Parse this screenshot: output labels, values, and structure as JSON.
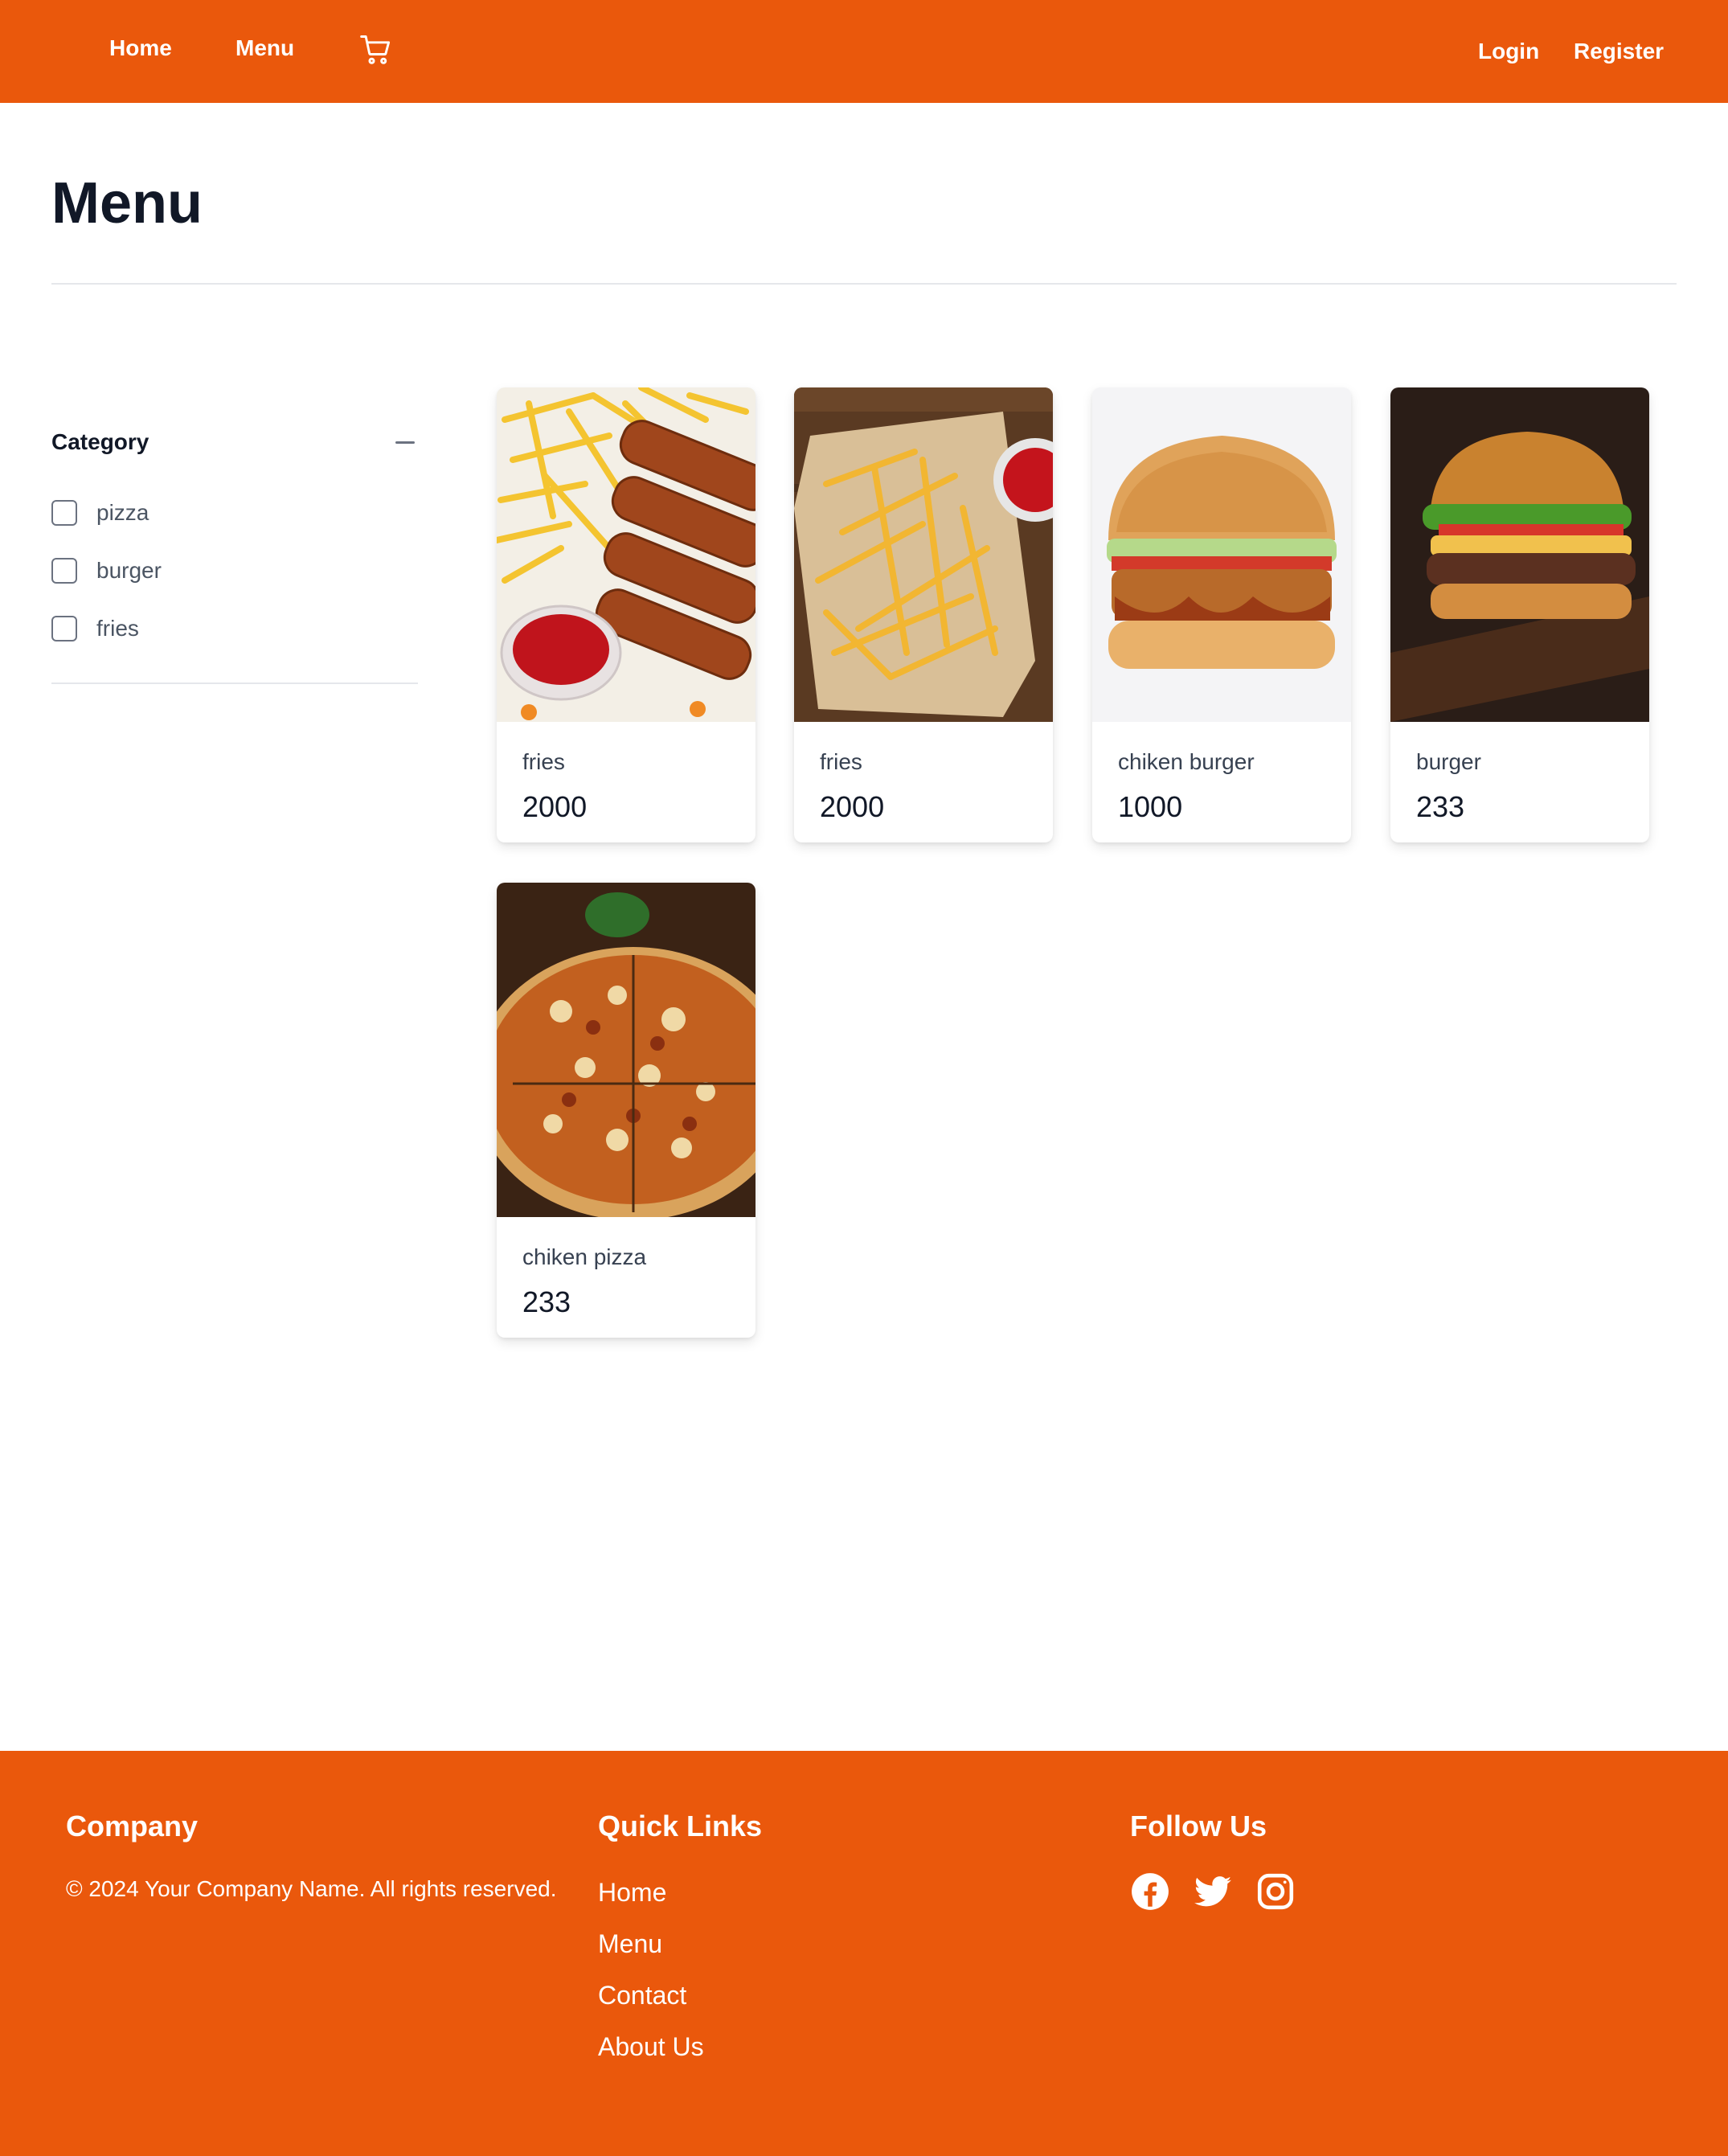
{
  "nav": {
    "home": "Home",
    "menu": "Menu",
    "cart_icon": "cart-icon",
    "login": "Login",
    "register": "Register"
  },
  "page": {
    "title": "Menu"
  },
  "filters": {
    "title": "Category",
    "toggle_icon": "minus-icon",
    "options": [
      {
        "label": "pizza",
        "checked": false
      },
      {
        "label": "burger",
        "checked": false
      },
      {
        "label": "fries",
        "checked": false
      }
    ]
  },
  "products": [
    {
      "name": "fries",
      "price": "2000",
      "image": "fries-with-chicken-fingers-and-ketchup"
    },
    {
      "name": "fries",
      "price": "2000",
      "image": "fries-on-paper-with-ketchup"
    },
    {
      "name": "chiken burger",
      "price": "1000",
      "image": "chicken-burger"
    },
    {
      "name": "burger",
      "price": "233",
      "image": "beef-burger"
    },
    {
      "name": "chiken pizza",
      "price": "233",
      "image": "chicken-pizza"
    }
  ],
  "footer": {
    "company_heading": "Company",
    "copyright": "© 2024 Your Company Name. All rights reserved.",
    "links_heading": "Quick Links",
    "links": [
      "Home",
      "Menu",
      "Contact",
      "About Us"
    ],
    "follow_heading": "Follow Us",
    "social_icons": [
      "facebook-icon",
      "twitter-icon",
      "instagram-icon"
    ]
  },
  "colors": {
    "brand": "#EA580C",
    "text_dark": "#111827",
    "text_muted": "#4b5563"
  }
}
